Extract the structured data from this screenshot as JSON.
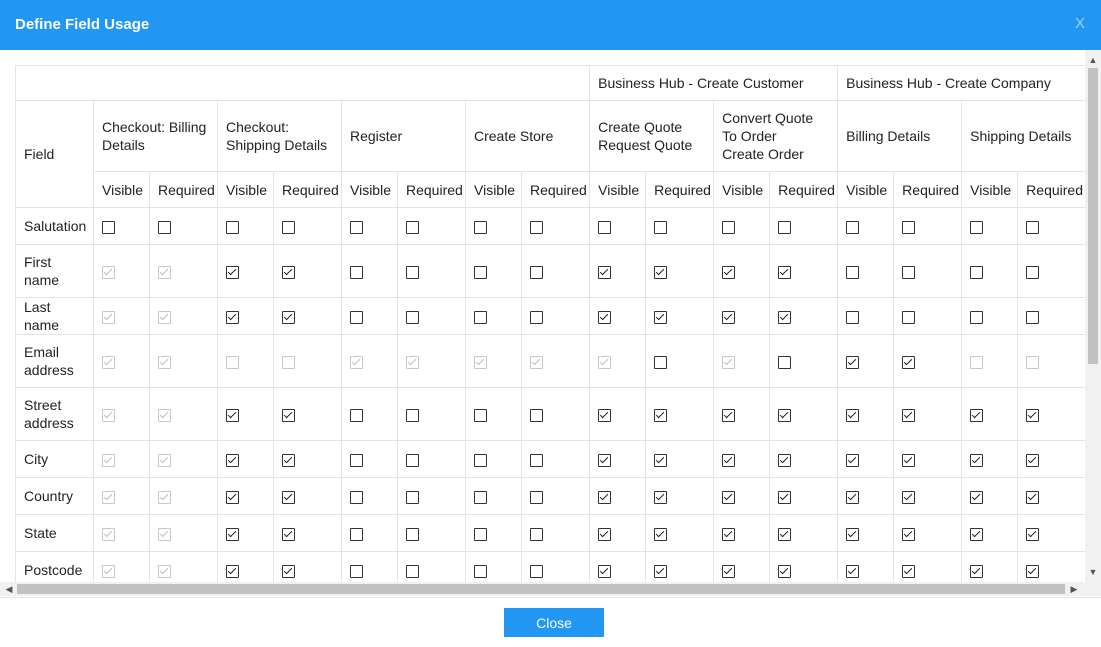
{
  "dialog": {
    "title": "Define Field Usage",
    "close_x": "X",
    "close_button": "Close"
  },
  "table": {
    "group_headers": [
      "Business Hub - Create Customer",
      "Business Hub - Create Company"
    ],
    "field_header": "Field",
    "forms": [
      "Checkout: Billing Details",
      "Checkout: Shipping Details",
      "Register",
      "Create Store",
      "Create Quote\nRequest Quote",
      "Convert Quote To Order\nCreate Order",
      "Billing Details",
      "Shipping Details"
    ],
    "visible_label": "Visible",
    "required_label": "Required",
    "rows": [
      {
        "field": "Salutation",
        "checked": [
          0,
          0,
          0,
          0,
          0,
          0,
          0,
          0,
          0,
          0,
          0,
          0,
          0,
          0,
          0,
          0
        ],
        "disabled": [
          0,
          0,
          0,
          0,
          0,
          0,
          0,
          0,
          0,
          0,
          0,
          0,
          0,
          0,
          0,
          0
        ]
      },
      {
        "field": "First name",
        "checked": [
          1,
          1,
          1,
          1,
          0,
          0,
          0,
          0,
          1,
          1,
          1,
          1,
          0,
          0,
          0,
          0
        ],
        "disabled": [
          1,
          1,
          0,
          0,
          0,
          0,
          0,
          0,
          0,
          0,
          0,
          0,
          0,
          0,
          0,
          0
        ]
      },
      {
        "field": "Last name",
        "checked": [
          1,
          1,
          1,
          1,
          0,
          0,
          0,
          0,
          1,
          1,
          1,
          1,
          0,
          0,
          0,
          0
        ],
        "disabled": [
          1,
          1,
          0,
          0,
          0,
          0,
          0,
          0,
          0,
          0,
          0,
          0,
          0,
          0,
          0,
          0
        ]
      },
      {
        "field": "Email address",
        "checked": [
          1,
          1,
          0,
          0,
          1,
          1,
          1,
          1,
          1,
          0,
          1,
          0,
          1,
          1,
          0,
          0
        ],
        "disabled": [
          1,
          1,
          1,
          1,
          1,
          1,
          1,
          1,
          1,
          0,
          1,
          0,
          0,
          0,
          1,
          1
        ]
      },
      {
        "field": "Street address",
        "checked": [
          1,
          1,
          1,
          1,
          0,
          0,
          0,
          0,
          1,
          1,
          1,
          1,
          1,
          1,
          1,
          1
        ],
        "disabled": [
          1,
          1,
          0,
          0,
          0,
          0,
          0,
          0,
          0,
          0,
          0,
          0,
          0,
          0,
          0,
          0
        ]
      },
      {
        "field": "City",
        "checked": [
          1,
          1,
          1,
          1,
          0,
          0,
          0,
          0,
          1,
          1,
          1,
          1,
          1,
          1,
          1,
          1
        ],
        "disabled": [
          1,
          1,
          0,
          0,
          0,
          0,
          0,
          0,
          0,
          0,
          0,
          0,
          0,
          0,
          0,
          0
        ]
      },
      {
        "field": "Country",
        "checked": [
          1,
          1,
          1,
          1,
          0,
          0,
          0,
          0,
          1,
          1,
          1,
          1,
          1,
          1,
          1,
          1
        ],
        "disabled": [
          1,
          1,
          0,
          0,
          0,
          0,
          0,
          0,
          0,
          0,
          0,
          0,
          0,
          0,
          0,
          0
        ]
      },
      {
        "field": "State",
        "checked": [
          1,
          1,
          1,
          1,
          0,
          0,
          0,
          0,
          1,
          1,
          1,
          1,
          1,
          1,
          1,
          1
        ],
        "disabled": [
          1,
          1,
          0,
          0,
          0,
          0,
          0,
          0,
          0,
          0,
          0,
          0,
          0,
          0,
          0,
          0
        ]
      },
      {
        "field": "Postcode",
        "checked": [
          1,
          1,
          1,
          1,
          0,
          0,
          0,
          0,
          1,
          1,
          1,
          1,
          1,
          1,
          1,
          1
        ],
        "disabled": [
          1,
          1,
          0,
          0,
          0,
          0,
          0,
          0,
          0,
          0,
          0,
          0,
          0,
          0,
          0,
          0
        ]
      }
    ]
  },
  "colors": {
    "accent": "#2196f3",
    "title_text": "#ffffff"
  }
}
